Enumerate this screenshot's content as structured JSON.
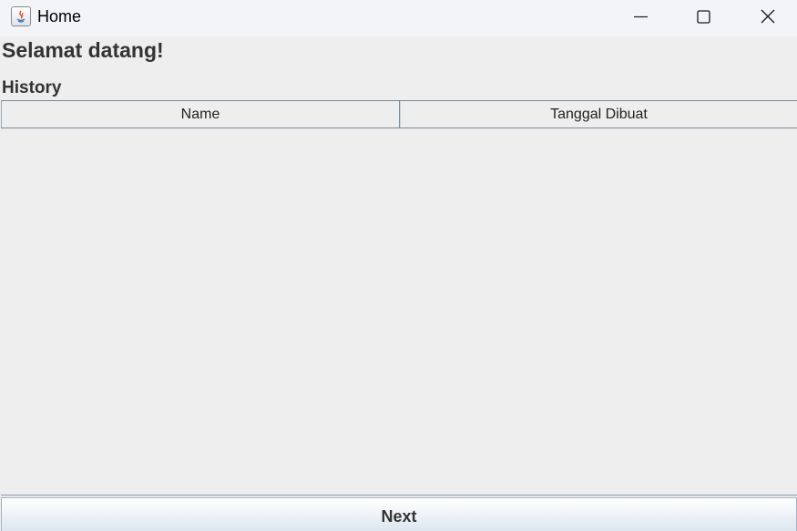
{
  "window": {
    "title": "Home",
    "controls": {
      "minimize": "minimize-icon",
      "maximize": "maximize-icon",
      "close": "close-icon"
    }
  },
  "main": {
    "welcome_text": "Selamat datang!",
    "history_label": "History",
    "table": {
      "columns": [
        "Name",
        "Tanggal Dibuat"
      ],
      "rows": []
    },
    "next_button_label": "Next"
  },
  "colors": {
    "background": "#eeeeee",
    "titlebar": "#f3f4f8",
    "text": "#333333",
    "grid_line": "#7a8a99"
  }
}
